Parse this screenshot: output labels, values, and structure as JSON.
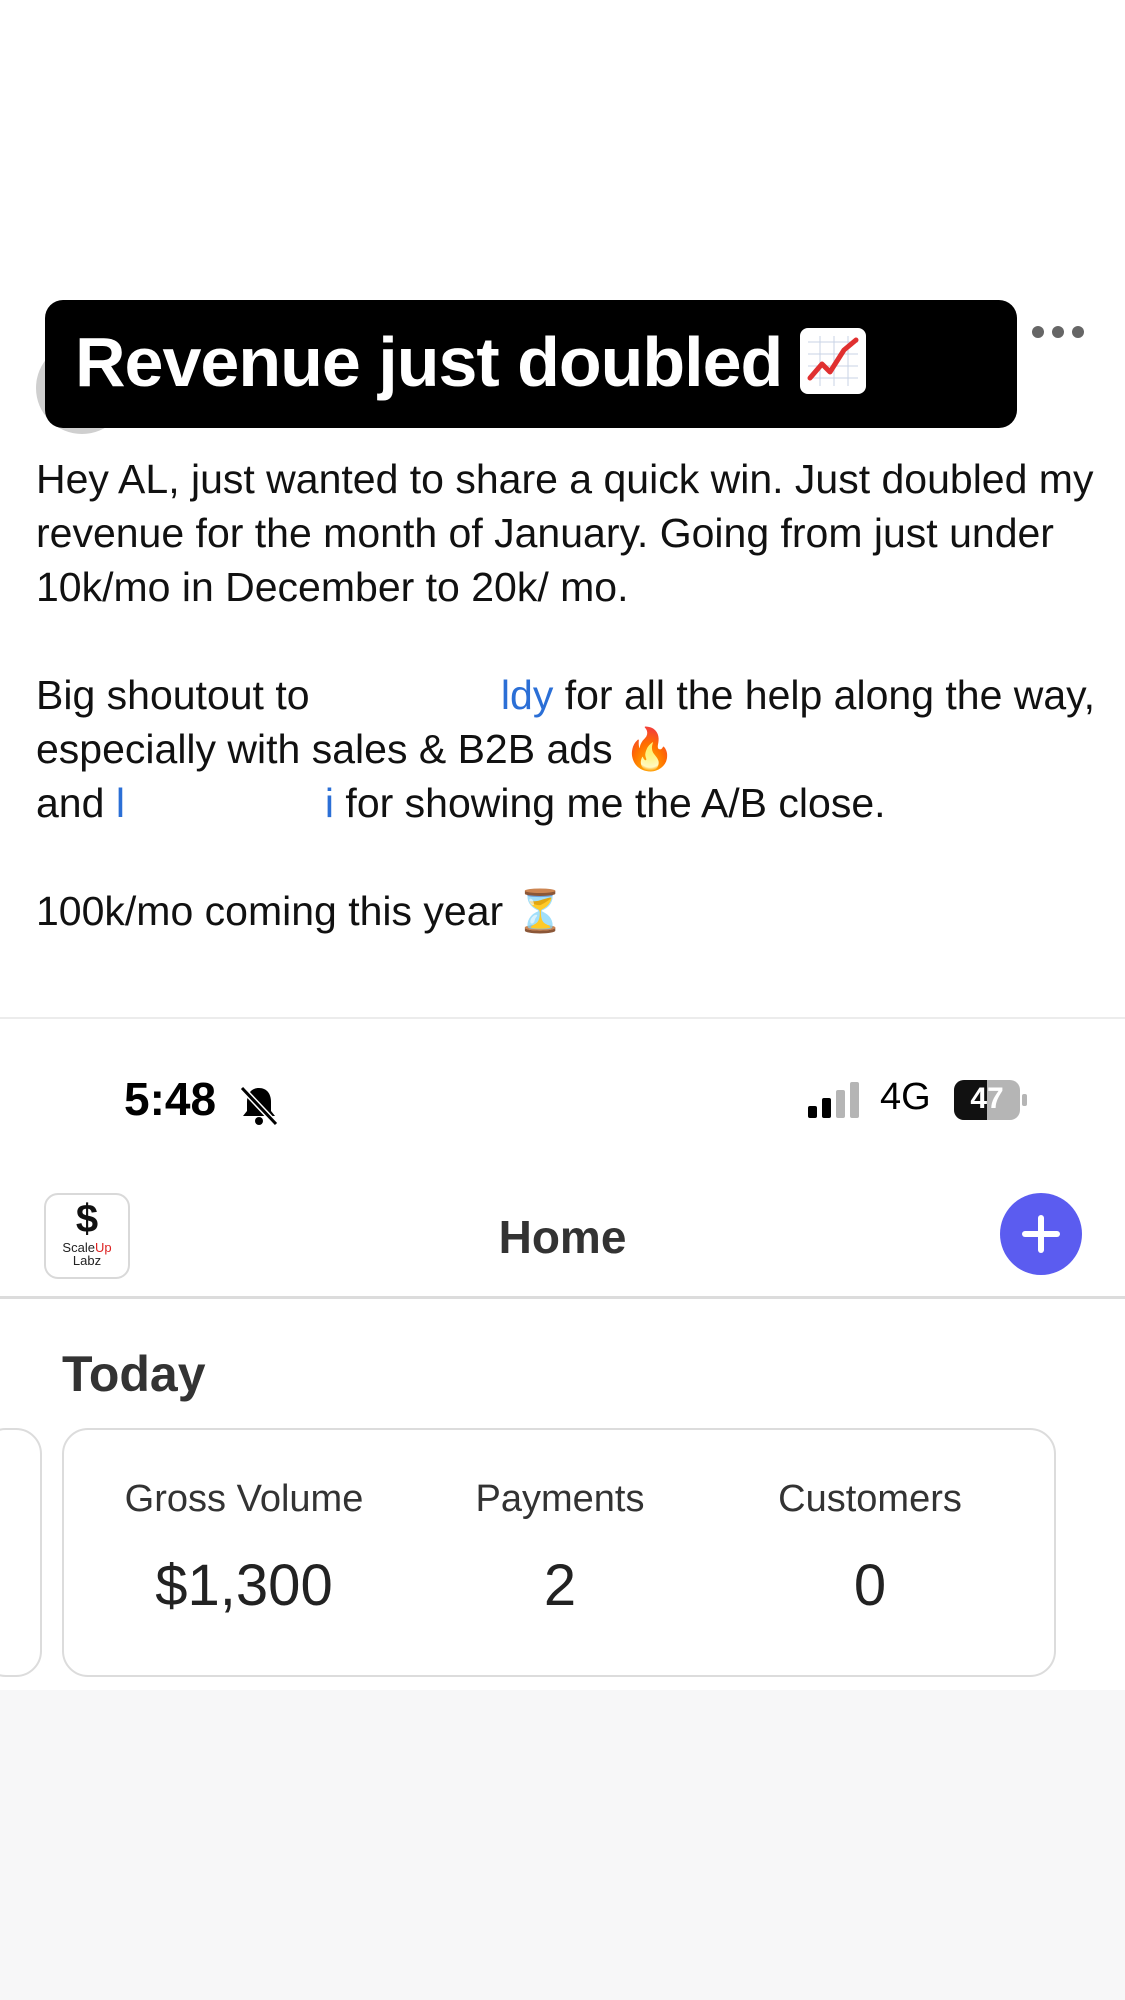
{
  "post": {
    "title": "Revenue just doubled",
    "paragraph1": "Hey AL, just wanted to share a quick win. Just doubled my revenue for the month of January. Going from just under 10k/mo in December to 20k/ mo.",
    "p2_start": "Big shoutout to ",
    "p2_mention1_tail": "ldy",
    "p2_mid": " for all the help along the way, especially with sales & B2B ads ",
    "p2_fire": "🔥",
    "p2_and": "and ",
    "p2_mention2_head": "l",
    "p2_mention2_tail": "i",
    "p2_end": " for showing me the A/B close.",
    "paragraph3": "100k/mo coming this year ",
    "hourglass": "⏳"
  },
  "status_bar": {
    "time": "5:48",
    "network": "4G",
    "battery": "47"
  },
  "app": {
    "logo_symbol": "$",
    "logo_line1_a": "Scale",
    "logo_line1_b": "Up",
    "logo_line2": "Labz",
    "title": "Home",
    "section": "Today"
  },
  "stats": [
    {
      "label": "Gross Volume",
      "value": "$1,300"
    },
    {
      "label": "Payments",
      "value": "2"
    },
    {
      "label": "Customers",
      "value": "0"
    }
  ],
  "colors": {
    "accent": "#5b5cf0",
    "mention": "#2b6fd6",
    "chart_line": "#e03030"
  },
  "icons": [
    "more-icon",
    "chart-increasing-icon",
    "bell-muted-icon",
    "signal-icon",
    "battery-icon",
    "add-icon"
  ]
}
